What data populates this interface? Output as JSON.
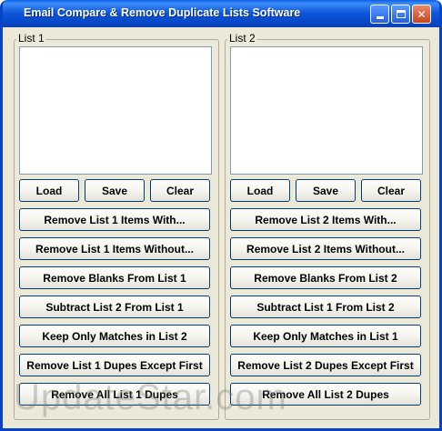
{
  "window": {
    "title": "Email Compare & Remove Duplicate Lists Software"
  },
  "list1": {
    "label": "List 1",
    "load": "Load",
    "save": "Save",
    "clear": "Clear",
    "actions": [
      "Remove List 1 Items With...",
      "Remove List 1 Items Without...",
      "Remove Blanks From List 1",
      "Subtract List 2 From List 1",
      "Keep Only Matches in List 2",
      "Remove List 1 Dupes Except First",
      "Remove All List 1 Dupes"
    ]
  },
  "list2": {
    "label": "List 2",
    "load": "Load",
    "save": "Save",
    "clear": "Clear",
    "actions": [
      "Remove List 2 Items With...",
      "Remove List 2 Items Without...",
      "Remove Blanks From List 2",
      "Subtract List 1 From List 2",
      "Keep Only Matches in List 1",
      "Remove List 2 Dupes Except First",
      "Remove All List 2 Dupes"
    ]
  },
  "watermark": "UpdateStar.com"
}
